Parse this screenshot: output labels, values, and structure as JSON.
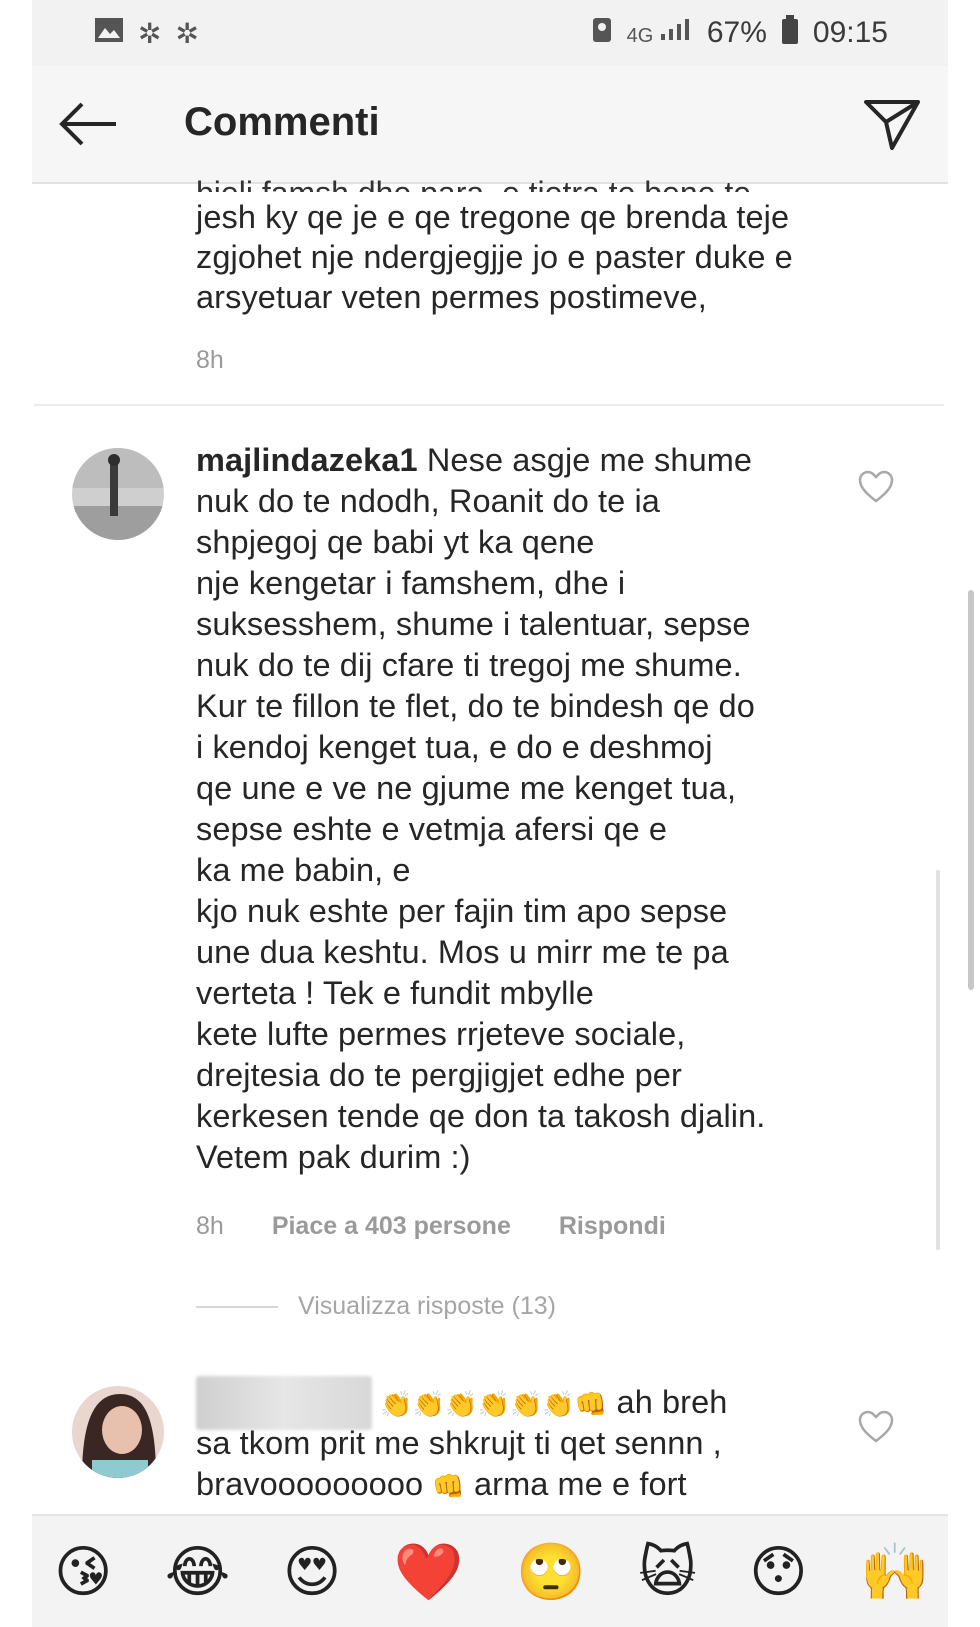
{
  "status_bar": {
    "left_icons": [
      "image-icon",
      "settings-icon",
      "settings-icon"
    ],
    "network": "4G",
    "battery": "67%",
    "time": "09:15"
  },
  "header": {
    "title": "Commenti"
  },
  "comments": [
    {
      "partial_top_line": "bjeli famsh dhe para, e tjetra te bene te",
      "lines": [
        "jesh ky qe je e qe tregone qe brenda teje",
        "zgjohet nje ndergjegjje jo e paster duke e",
        "arsyetuar veten permes postimeve,"
      ],
      "time": "8h"
    },
    {
      "username": "majlindazeka1",
      "first_line_text": "Nese asgje me shume",
      "lines": [
        "nuk do te ndodh, Roanit do te ia",
        "shpjegoj qe babi yt ka qene",
        "nje kengetar i famshem, dhe i",
        "suksesshem, shume i talentuar, sepse",
        "nuk do te dij cfare ti tregoj me shume.",
        "Kur te fillon te flet, do te bindesh qe do",
        "i kendoj kenget tua, e do e deshmoj",
        "qe une e ve ne gjume me kenget tua,",
        "sepse eshte e vetmja afersi qe e",
        "ka me babin, e",
        "kjo nuk eshte per fajin tim apo sepse",
        "une dua keshtu. Mos u mirr me te pa",
        "verteta ! Tek e fundit mbylle",
        "kete lufte permes rrjeteve sociale,",
        "drejtesia do te pergjigjet edhe per",
        "kerkesen tende qe don ta takosh djalin.",
        "Vetem pak durim :)"
      ],
      "time": "8h",
      "likes": "Piace a 403 persone",
      "reply": "Rispondi",
      "view_replies": "Visualizza risposte (13)"
    },
    {
      "line1_suffix": "ah breh",
      "line2": "sa tkom prit me shkrujt ti qet sennn ,",
      "line3_prefix": "bravooooooooo",
      "line3_suffix": "arma me e fort",
      "emoji_clap": "👏",
      "emoji_fist": "👊"
    }
  ],
  "emoji_bar": [
    "😘",
    "😂",
    "😍",
    "❤️",
    "🙄",
    "🙀",
    "😯",
    "🙌"
  ]
}
